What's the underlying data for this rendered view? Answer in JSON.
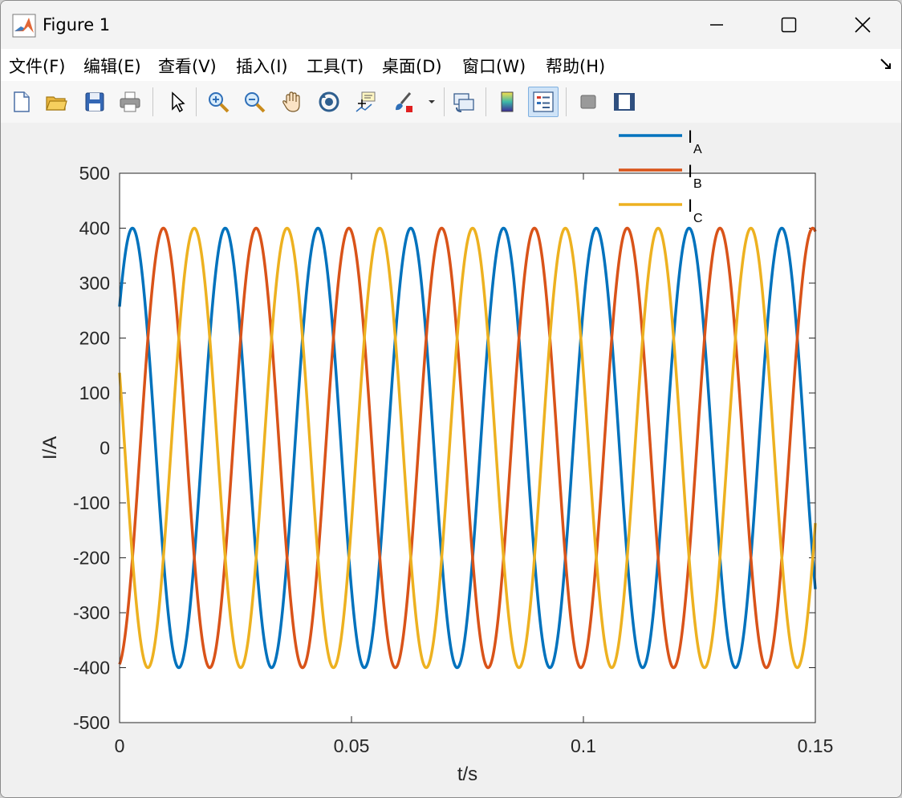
{
  "window": {
    "title": "Figure 1"
  },
  "menu": [
    "文件(F)",
    "编辑(E)",
    "查看(V)",
    "插入(I)",
    "工具(T)",
    "桌面(D)",
    "窗口(W)",
    "帮助(H)"
  ],
  "toolbar": [
    "new-figure-icon",
    "open-file-icon",
    "save-icon",
    "print-icon",
    "pointer-icon",
    "zoom-in-icon",
    "zoom-out-icon",
    "pan-hand-icon",
    "rotate-3d-icon",
    "data-cursor-icon",
    "brush-icon",
    "link-plot-icon",
    "colorbar-icon",
    "legend-icon",
    "hide-plot-tools-icon",
    "show-plot-tools-icon"
  ],
  "chart_data": {
    "type": "line",
    "title": "",
    "xlabel": "t/s",
    "ylabel": "I/A",
    "xlim": [
      0,
      0.15
    ],
    "ylim": [
      -500,
      500
    ],
    "xticks": [
      0,
      0.05,
      0.1,
      0.15
    ],
    "xtick_labels": [
      "0",
      "0.05",
      "0.1",
      "0.15"
    ],
    "yticks": [
      500,
      400,
      300,
      200,
      100,
      0,
      -100,
      -200,
      -300,
      -400,
      -500
    ],
    "ytick_labels": [
      "500",
      "400",
      "300",
      "200",
      "100",
      "0",
      "-100",
      "-200",
      "-300",
      "-400",
      "-500"
    ],
    "grid": false,
    "legend": {
      "position": "top-right, above axes"
    },
    "frequency_hz": 50,
    "amplitude": 400,
    "series": [
      {
        "name": "I",
        "subscript": "A",
        "color": "#0072BD",
        "phase_deg": 40,
        "value_at_t0": 257
      },
      {
        "name": "I",
        "subscript": "B",
        "color": "#D95319",
        "phase_deg": -80,
        "value_at_t0": -394
      },
      {
        "name": "I",
        "subscript": "C",
        "color": "#EDB120",
        "phase_deg": 160,
        "value_at_t0": 137
      }
    ]
  }
}
